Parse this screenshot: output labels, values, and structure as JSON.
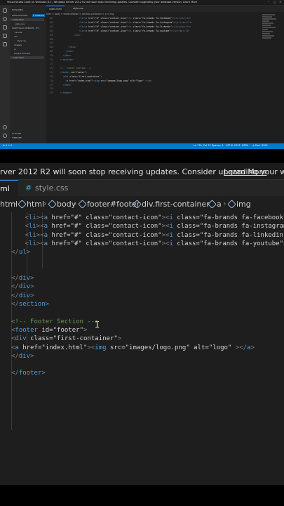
{
  "mini": {
    "title": "Visual Studio Code on Windows 8.1 / Windows Server 2012 R2 will soon stop receiving updates. Consider upgrading your windows version.  Learn More",
    "explorer_label": "EXPLORER",
    "open_editors": "OPEN EDITORS",
    "badge": "1 unsaved",
    "files": [
      "index.html",
      "style.css"
    ],
    "project": "PORTFOLIO WEBSITE - ET...",
    "folders": [
      ".vscode",
      "css",
      "style.css",
      "images",
      "js",
      "Project Preview",
      "index.html"
    ],
    "outline": "OUTLINE",
    "timeline": "TIMELINE",
    "tabs": [
      "index.html",
      "style.css"
    ],
    "crumbs": "html > body > footer#footer > div.first-container > a > img",
    "status": {
      "left": "⊗ 0 ⚠ 0",
      "right": [
        "Ln 170, Col 72",
        "Spaces: 4",
        "UTF-8",
        "CRLF",
        "HTML",
        "◎ Port: 5500"
      ]
    },
    "lines": [
      {
        "n": "161",
        "code": "                <li><a href=\"#\" class=\"contact-icon\"><i class=\"fa-brands fa-facebook\"></i></a></li>"
      },
      {
        "n": "162",
        "code": "                <li><a href=\"#\" class=\"contact-icon\"><i class=\"fa-brands fa-instagram\"></i></a></li>"
      },
      {
        "n": "163",
        "code": "                <li><a href=\"#\" class=\"contact-icon\"><i class=\"fa-brands fa-linkedin\"></i></a></li>"
      },
      {
        "n": "164",
        "code": "                <li><a href=\"#\" class=\"contact-icon\"><i class=\"fa-brands fa-youtube\"></i></a></li>"
      },
      {
        "n": "165",
        "code": "            </ul>"
      },
      {
        "n": "166",
        "code": ""
      },
      {
        "n": "167",
        "code": ""
      },
      {
        "n": "168",
        "code": "        </div>"
      },
      {
        "n": "169",
        "code": "      </div>"
      },
      {
        "n": "170",
        "code": "    </div>"
      },
      {
        "n": "171",
        "code": "  </section>"
      },
      {
        "n": "172",
        "code": ""
      },
      {
        "n": "173",
        "code": "  <!-- Footer Section -->"
      },
      {
        "n": "174",
        "code": "  <footer id=\"footer\">"
      },
      {
        "n": "175",
        "code": "    <div class=\"first-container\">"
      },
      {
        "n": "176",
        "code": "      <a href=\"index.html\"><img src=\"images/logo.png\" alt=\"logo\" ></a>"
      },
      {
        "n": "177",
        "code": "    </div>"
      },
      {
        "n": "178",
        "code": ""
      },
      {
        "n": "179",
        "code": "  </footer>"
      }
    ]
  },
  "zoom": {
    "banner": "rver 2012 R2 will soon stop receiving updates. Consider upgrading your windows version.",
    "learn_more": "Learn More",
    "tab_active": "ml",
    "tab_css": "style.css",
    "crumbs": [
      "html",
      "html",
      "body",
      "footer#footer",
      "div.first-container",
      "a",
      "img"
    ]
  },
  "colors": {
    "tag": "#569cd6",
    "attr": "#9cdcfe",
    "string": "#ce9178",
    "comment": "#6a9955",
    "status": "#007acc"
  }
}
